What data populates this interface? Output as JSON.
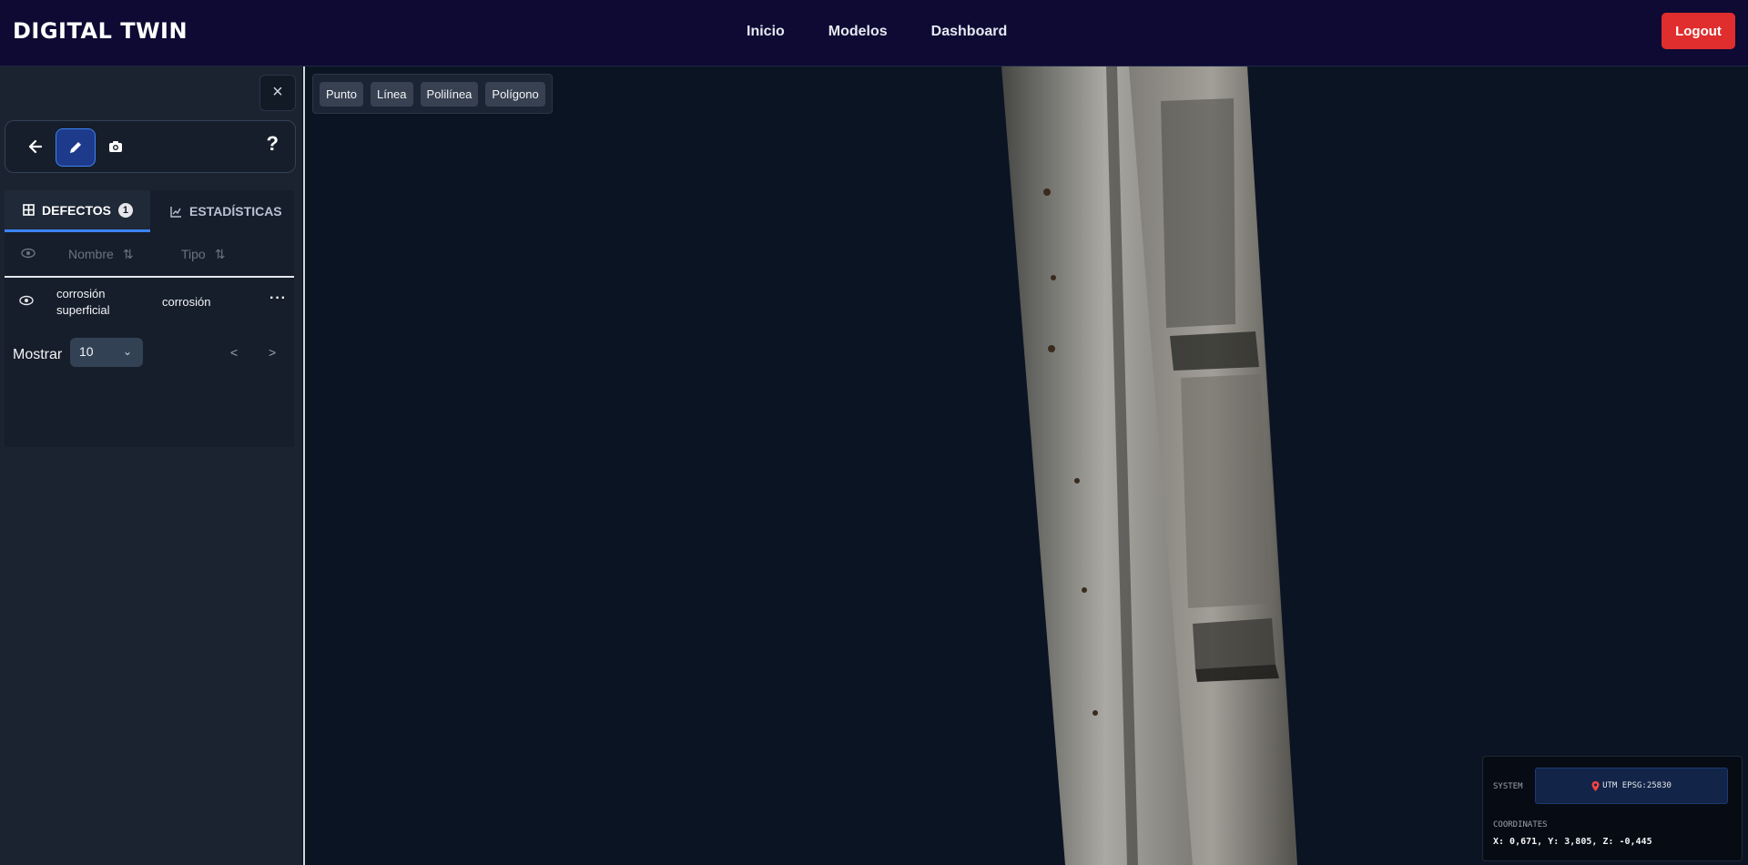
{
  "header": {
    "brand": "DIGITAL TWIN",
    "nav": [
      "Inicio",
      "Modelos",
      "Dashboard"
    ],
    "logout": "Logout"
  },
  "sidebar": {
    "close_glyph": "×",
    "tools": {
      "icons": [
        "back-arrow-icon",
        "pencil-icon",
        "camera-icon"
      ],
      "active_index": 1,
      "help_glyph": "?"
    },
    "tabs": [
      {
        "label": "DEFECTOS",
        "count": "1",
        "icon": "table-icon",
        "active": true
      },
      {
        "label": "ESTADÍSTICAS",
        "icon": "chart-icon",
        "active": false
      }
    ],
    "table": {
      "columns": [
        "Nombre",
        "Tipo"
      ],
      "rows": [
        {
          "nombre": "corrosión superficial",
          "tipo": "corrosión"
        }
      ]
    },
    "pager": {
      "label": "Mostrar",
      "page_size": "10",
      "prev": "<",
      "next": ">"
    }
  },
  "viewport": {
    "draw_tools": [
      "Punto",
      "Línea",
      "Polilínea",
      "Polígono"
    ],
    "coords": {
      "system_label": "SYSTEM",
      "system_value": "UTM EPSG:25830",
      "coordinates_label": "COORDINATES",
      "coordinates_value": "X: 0,671, Y: 3,805, Z: -0,445"
    }
  },
  "colors": {
    "topbar": "#0e0a33",
    "logout": "#e02d2d",
    "accent": "#3b82f6",
    "sidebar": "#1b2331",
    "viewport": "#0b1422"
  }
}
